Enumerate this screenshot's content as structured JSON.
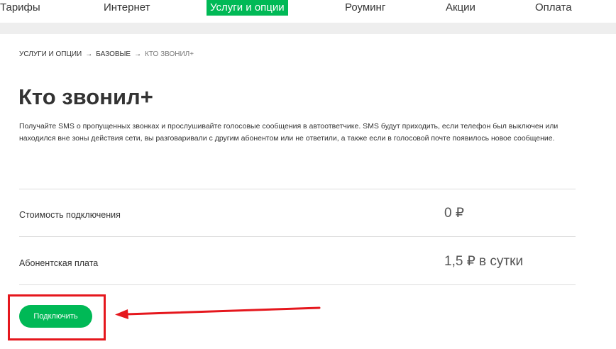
{
  "nav": {
    "items": [
      {
        "label": "Тарифы",
        "active": false
      },
      {
        "label": "Интернет",
        "active": false
      },
      {
        "label": "Услуги и опции",
        "active": true
      },
      {
        "label": "Роуминг",
        "active": false
      },
      {
        "label": "Акции",
        "active": false
      },
      {
        "label": "Оплата",
        "active": false
      }
    ]
  },
  "breadcrumb": {
    "items": [
      "УСЛУГИ И ОПЦИИ",
      "БАЗОВЫЕ",
      "КТО ЗВОНИЛ+"
    ],
    "separator": "→"
  },
  "page": {
    "title": "Кто звонил+",
    "description": "Получайте SMS о пропущенных звонках и прослушивайте голосовые сообщения в автоответчике. SMS будут приходить, если телефон был выключен или находился вне зоны действия сети, вы разговаривали с другим абонентом или не ответили, а также если в голосовой почте появилось новое сообщение."
  },
  "pricing": [
    {
      "label": "Стоимость подключения",
      "value": "0 ₽"
    },
    {
      "label": "Абонентская плата",
      "value": "1,5 ₽ в сутки"
    }
  ],
  "actions": {
    "connect_label": "Подключить"
  },
  "colors": {
    "brand_green": "#00b956",
    "highlight_red": "#e5171d",
    "text": "#333333"
  }
}
